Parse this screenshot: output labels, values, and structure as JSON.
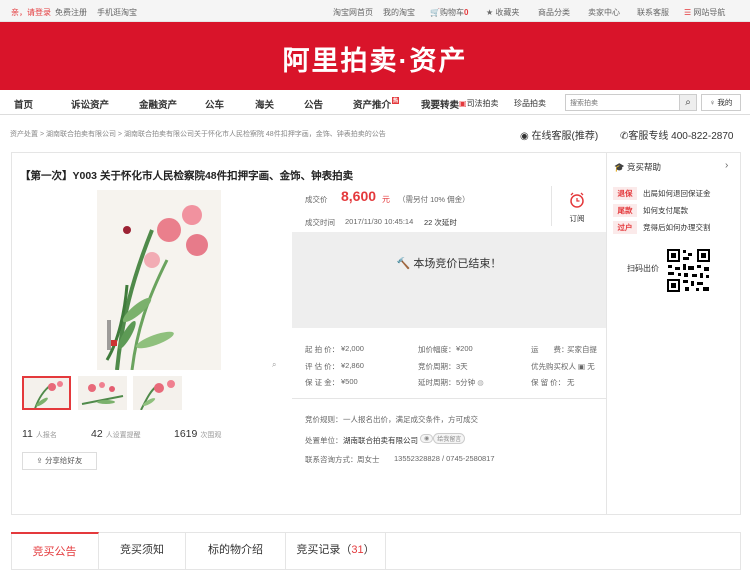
{
  "topbar": {
    "welcome": "亲，请登录",
    "register": "免费注册",
    "mobile": "手机逛淘宝",
    "home": "淘宝网首页",
    "my_taobao": "我的淘宝",
    "cart_label": "购物车",
    "cart_count": "0",
    "favorites": "收藏夹",
    "categories": "商品分类",
    "seller_center": "卖家中心",
    "contact": "联系客服",
    "sitemap": "网站导航"
  },
  "brand": {
    "logo_text": "阿里拍卖·资产"
  },
  "nav": {
    "items": [
      "首页",
      "诉讼资产",
      "金融资产",
      "公车",
      "海关",
      "公告",
      "资产推介",
      "我要转卖"
    ],
    "hot_badge": "热",
    "sub_items": [
      "司法拍卖",
      "珍品拍卖"
    ],
    "search_placeholder": "搜索拍卖",
    "mine_label": "我的"
  },
  "breadcrumb": {
    "root": "资产处置",
    "org": "湖南联合拍卖有限公司",
    "current": "湖南联合拍卖有限公司关于怀化市人民检察院 48件扣押字画，金饰、钟表拍卖的公告"
  },
  "service": {
    "online": "在线客服(推荐)",
    "hotline": "客服专线 400-822-2870"
  },
  "lot": {
    "title": "【第一次】Y003 关于怀化市人民检察院48件扣押字画、金饰、钟表拍卖",
    "deal_label": "成交价",
    "deal_price": "8,600",
    "deal_unit": "元",
    "commission": "（需另付 10% 佣金）",
    "deal_time_label": "成交时间",
    "deal_time": "2017/11/30 10:45:14",
    "delay_note": "22 次延时",
    "remind_label": "订阅",
    "ended_text": "本场竞价已结束！"
  },
  "details": {
    "start_label": "起 拍 价：",
    "start_value": "¥2,000",
    "increment_label": "加价幅度：",
    "increment_value": "¥200",
    "shipping_label": "运　　费：",
    "shipping_value": "买家自提",
    "appraise_label": "评 估 价：",
    "appraise_value": "¥2,860",
    "period_label": "竞价周期：",
    "period_value": "3天",
    "priority_label": "优先购买权人",
    "priority_value": "无",
    "deposit_label": "保 证 金：",
    "deposit_value": "¥500",
    "delay_label": "延时周期：",
    "delay_value": "5分钟",
    "reserve_label": "保 留 价：",
    "reserve_value": "无",
    "rule_label": "竞价规则：",
    "rule_value": "一人报名出价，满足成交条件，方可成交",
    "unit_label": "处置单位：",
    "unit_value": "湖南联合拍卖有限公司",
    "unit_tag": "给我留言",
    "contact_label": "联系咨询方式：",
    "contact_name": "周女士",
    "contact_phone": "13552328828 / 0745-2580817"
  },
  "stats": {
    "signups": "11",
    "signups_label": "人报名",
    "reminders": "42",
    "reminders_label": "人设置提醒",
    "views": "1619",
    "views_label": "次围观"
  },
  "share_label": "分享给好友",
  "zoom_icon": "magnifier-icon",
  "help": {
    "title": "竞买帮助",
    "items": [
      {
        "badge": "退保",
        "text": "出局如何退回保证金"
      },
      {
        "badge": "尾款",
        "text": "如何支付尾款"
      },
      {
        "badge": "过户",
        "text": "竞得后如何办理交割"
      }
    ],
    "scan_label": "扫码出价"
  },
  "tabs": [
    {
      "label": "竞买公告"
    },
    {
      "label": "竞买须知"
    },
    {
      "label": "标的物介绍"
    },
    {
      "label": "竞买记录",
      "count": "31"
    }
  ],
  "colors": {
    "brand_red": "#d9142a",
    "accent": "#e4393c"
  }
}
